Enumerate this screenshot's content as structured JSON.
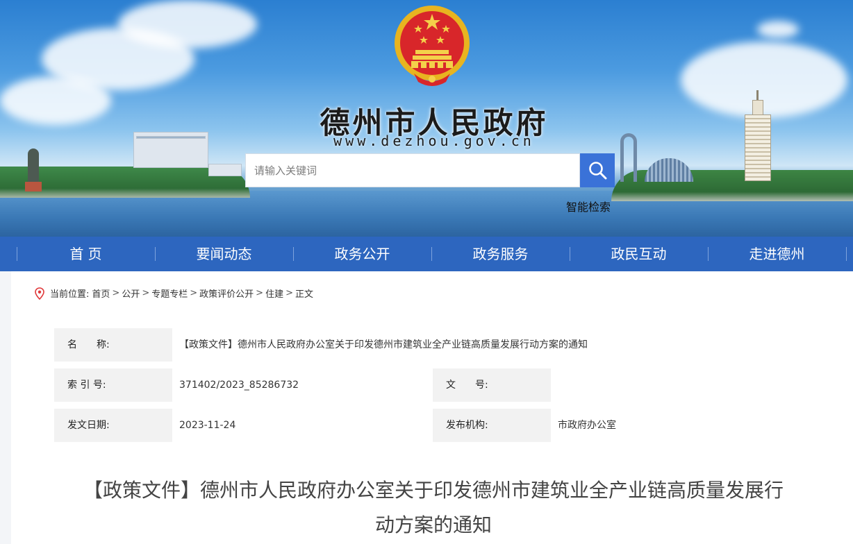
{
  "header": {
    "site_title": "德州市人民政府",
    "site_url": "www.dezhou.gov.cn",
    "search_placeholder": "请输入关键词",
    "smart_search_label": "智能检索"
  },
  "nav": {
    "items": [
      "首 页",
      "要闻动态",
      "政务公开",
      "政务服务",
      "政民互动",
      "走进德州"
    ]
  },
  "breadcrumb": {
    "prefix": "当前位置:",
    "items": [
      "首页",
      "公开",
      "专题专栏",
      "政策评价公开",
      "住建",
      "正文"
    ],
    "separator": ">"
  },
  "meta": {
    "name_label": "名　　称:",
    "name_value": "【政策文件】德州市人民政府办公室关于印发德州市建筑业全产业链高质量发展行动方案的通知",
    "index_label": "索 引 号:",
    "index_value": "371402/2023_85286732",
    "doc_no_label": "文　　号:",
    "doc_no_value": "",
    "date_label": "发文日期:",
    "date_value": "2023-11-24",
    "org_label": "发布机构:",
    "org_value": "市政府办公室"
  },
  "document": {
    "title_line1": "【政策文件】德州市人民政府办公室关于印发德州市建筑业全产业链高质量发展行",
    "title_line2": "动方案的通知"
  },
  "colors": {
    "nav_bg": "#2d66bf",
    "search_button": "#3a72d8",
    "meta_label_bg": "#f2f2f2"
  }
}
